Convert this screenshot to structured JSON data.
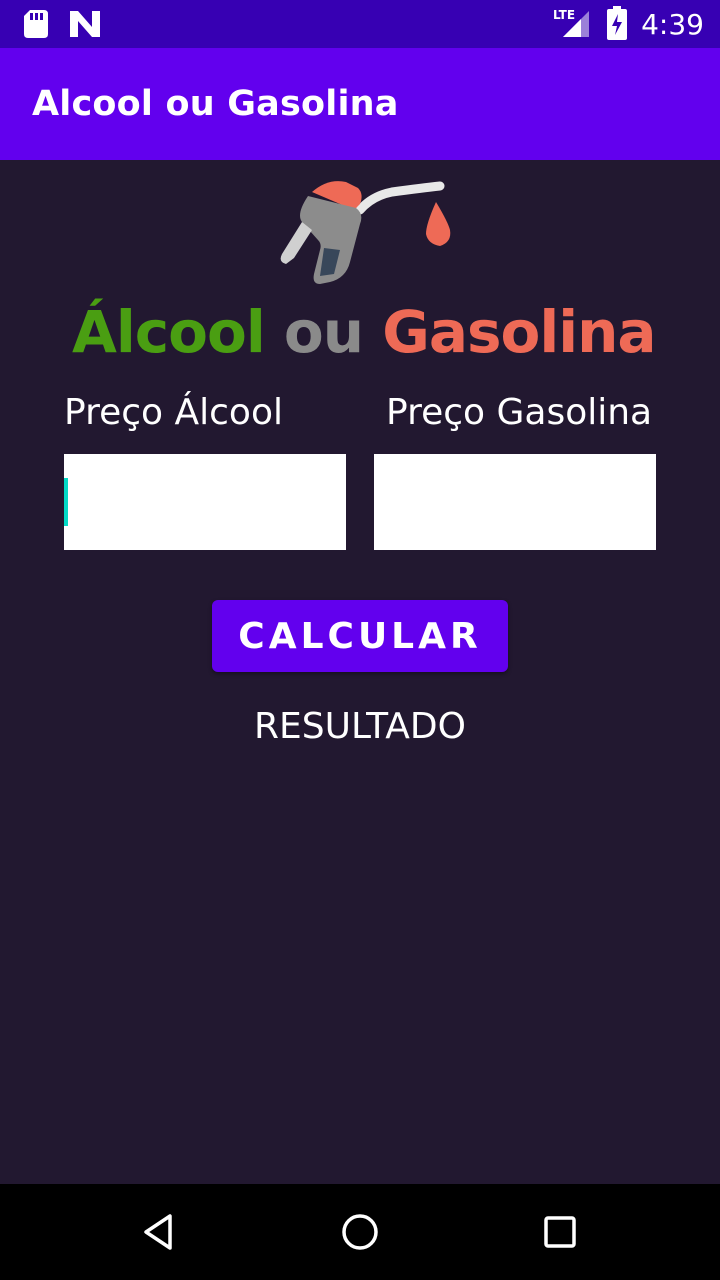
{
  "statusbar": {
    "time": "4:39",
    "network": "LTE",
    "icons": [
      "sd-card-icon",
      "n-logo-icon",
      "lte-signal-icon",
      "battery-charging-icon"
    ]
  },
  "appbar": {
    "title": "Alcool ou Gasolina"
  },
  "logo": {
    "word1": "Álcool",
    "word2": " ou ",
    "word3": "Gasolina",
    "colors": {
      "word1": "#4a9e12",
      "word2": "#8a8a8a",
      "word3": "#ee6a56"
    }
  },
  "form": {
    "label_alcool": "Preço Álcool",
    "label_gasolina": "Preço Gasolina",
    "input_alcool_value": "",
    "input_gasolina_value": ""
  },
  "button": {
    "label": "CALCULAR"
  },
  "result": {
    "text": "RESULTADO"
  },
  "navbar": {
    "icons": [
      "back-icon",
      "home-icon",
      "recents-icon"
    ]
  },
  "colors": {
    "statusbar": "#3700b3",
    "appbar": "#6200ee",
    "background": "#221830",
    "accent": "#03dac6"
  }
}
